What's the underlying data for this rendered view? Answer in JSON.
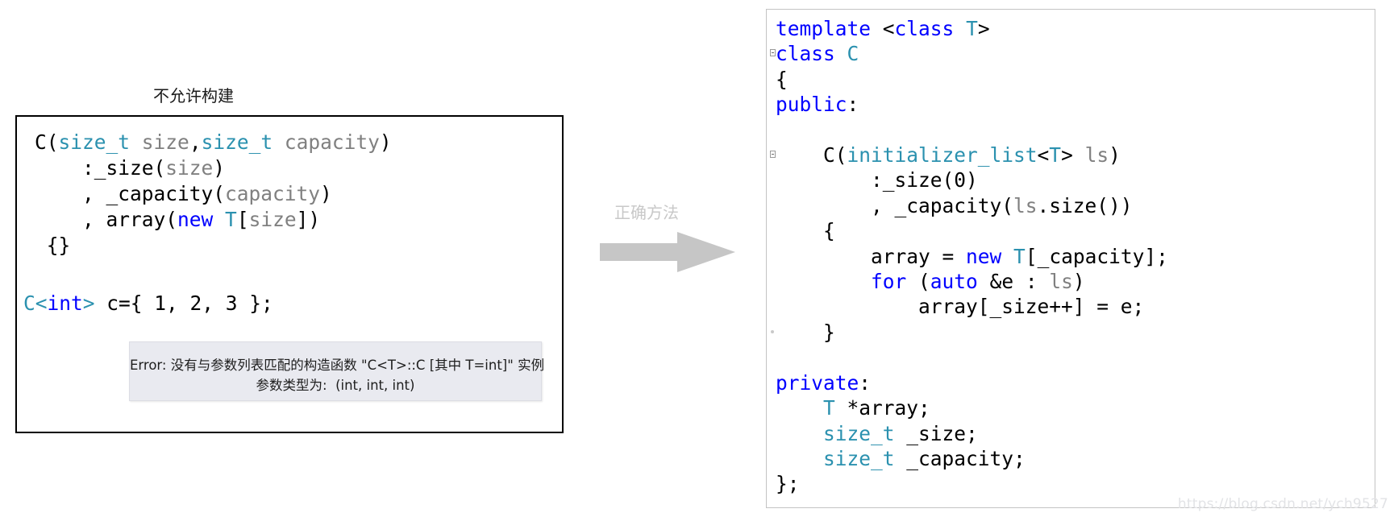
{
  "left": {
    "caption": "不允许构建",
    "code_main": [
      [
        {
          "t": "C(",
          "c": "plain"
        },
        {
          "t": "size_t",
          "c": "type"
        },
        {
          "t": " ",
          "c": "plain"
        },
        {
          "t": "size",
          "c": "param"
        },
        {
          "t": ",",
          "c": "plain"
        },
        {
          "t": "size_t",
          "c": "type"
        },
        {
          "t": " ",
          "c": "plain"
        },
        {
          "t": "capacity",
          "c": "param"
        },
        {
          "t": ")",
          "c": "plain"
        }
      ],
      [
        {
          "t": "    :_size(",
          "c": "plain"
        },
        {
          "t": "size",
          "c": "param"
        },
        {
          "t": ")",
          "c": "plain"
        }
      ],
      [
        {
          "t": "    , _capacity(",
          "c": "plain"
        },
        {
          "t": "capacity",
          "c": "param"
        },
        {
          "t": ")",
          "c": "plain"
        }
      ],
      [
        {
          "t": "    , array(",
          "c": "plain"
        },
        {
          "t": "new",
          "c": "kw"
        },
        {
          "t": " ",
          "c": "plain"
        },
        {
          "t": "T",
          "c": "type"
        },
        {
          "t": "[",
          "c": "plain"
        },
        {
          "t": "size",
          "c": "param"
        },
        {
          "t": "])",
          "c": "plain"
        }
      ],
      [
        {
          "t": " {}",
          "c": "plain"
        }
      ]
    ],
    "code_tail": [
      [
        {
          "t": "C<",
          "c": "type"
        },
        {
          "t": "int",
          "c": "kw"
        },
        {
          "t": "> ",
          "c": "type"
        },
        {
          "t": "c={ 1, 2, 3 };",
          "c": "plain"
        }
      ]
    ],
    "tooltip": {
      "line1": "Error: 没有与参数列表匹配的构造函数 \"C<T>::C [其中 T=int]\" 实例",
      "line2": "参数类型为:  (int, int, int)"
    }
  },
  "middle": {
    "label": "正确方法",
    "arrow_icon": "right-arrow-icon",
    "arrow_color": "#c6c6c6"
  },
  "right": {
    "code": [
      [
        {
          "t": "template ",
          "c": "kw"
        },
        {
          "t": "<",
          "c": "plain"
        },
        {
          "t": "class",
          "c": "kw"
        },
        {
          "t": " ",
          "c": "plain"
        },
        {
          "t": "T",
          "c": "type"
        },
        {
          "t": ">",
          "c": "plain"
        }
      ],
      [
        {
          "t": "class",
          "c": "kw"
        },
        {
          "t": " ",
          "c": "plain"
        },
        {
          "t": "C",
          "c": "type"
        }
      ],
      [
        {
          "t": "{",
          "c": "plain"
        }
      ],
      [
        {
          "t": "public",
          "c": "kw"
        },
        {
          "t": ":",
          "c": "plain"
        }
      ],
      [
        {
          "t": "",
          "c": "plain"
        }
      ],
      [
        {
          "t": "    C(",
          "c": "plain"
        },
        {
          "t": "initializer_list",
          "c": "type"
        },
        {
          "t": "<",
          "c": "plain"
        },
        {
          "t": "T",
          "c": "type"
        },
        {
          "t": "> ",
          "c": "plain"
        },
        {
          "t": "ls",
          "c": "param"
        },
        {
          "t": ")",
          "c": "plain"
        }
      ],
      [
        {
          "t": "        :_size(0)",
          "c": "plain"
        }
      ],
      [
        {
          "t": "        , _capacity(",
          "c": "plain"
        },
        {
          "t": "ls",
          "c": "param"
        },
        {
          "t": ".size())",
          "c": "plain"
        }
      ],
      [
        {
          "t": "    {",
          "c": "plain"
        }
      ],
      [
        {
          "t": "        array = ",
          "c": "plain"
        },
        {
          "t": "new",
          "c": "kw"
        },
        {
          "t": " ",
          "c": "plain"
        },
        {
          "t": "T",
          "c": "type"
        },
        {
          "t": "[_capacity];",
          "c": "plain"
        }
      ],
      [
        {
          "t": "        ",
          "c": "plain"
        },
        {
          "t": "for",
          "c": "kw"
        },
        {
          "t": " (",
          "c": "plain"
        },
        {
          "t": "auto",
          "c": "kw"
        },
        {
          "t": " &e : ",
          "c": "plain"
        },
        {
          "t": "ls",
          "c": "param"
        },
        {
          "t": ")",
          "c": "plain"
        }
      ],
      [
        {
          "t": "            array[_size++] = e;",
          "c": "plain"
        }
      ],
      [
        {
          "t": "    }",
          "c": "plain"
        }
      ],
      [
        {
          "t": "",
          "c": "plain"
        }
      ],
      [
        {
          "t": "private",
          "c": "kw"
        },
        {
          "t": ":",
          "c": "plain"
        }
      ],
      [
        {
          "t": "    ",
          "c": "plain"
        },
        {
          "t": "T",
          "c": "type"
        },
        {
          "t": " *array;",
          "c": "plain"
        }
      ],
      [
        {
          "t": "    ",
          "c": "plain"
        },
        {
          "t": "size_t",
          "c": "type"
        },
        {
          "t": " _size;",
          "c": "plain"
        }
      ],
      [
        {
          "t": "    ",
          "c": "plain"
        },
        {
          "t": "size_t",
          "c": "type"
        },
        {
          "t": " _capacity;",
          "c": "plain"
        }
      ],
      [
        {
          "t": "};",
          "c": "plain"
        }
      ]
    ],
    "gutter_marks": [
      {
        "type": "fold",
        "line": 1
      },
      {
        "type": "fold",
        "line": 5
      },
      {
        "type": "dot",
        "line": 12
      }
    ]
  },
  "watermark": "https://blog.csdn.net/ych9527",
  "colors": {
    "keyword": "#0000ff",
    "type": "#2b91af",
    "param": "#808080",
    "plain": "#000000",
    "left_panel_border": "#000000",
    "right_panel_border": "#c3c3c3",
    "tooltip_bg": "#e9eaf0",
    "arrow": "#c6c6c6",
    "watermark": "#e2e3e6"
  }
}
